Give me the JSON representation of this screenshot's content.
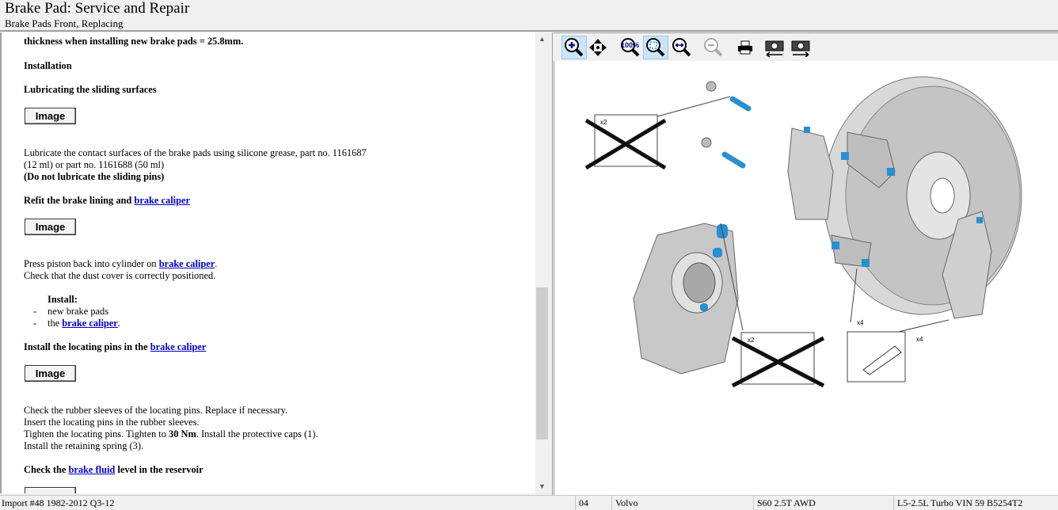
{
  "header": {
    "title": "Brake Pad:  Service and Repair",
    "subtitle": "Brake Pads Front, Replacing"
  },
  "content": {
    "top_line": "thickness when installing new brake pads = 25.8mm.",
    "installation": "Installation",
    "lubricating": "Lubricating the sliding surfaces",
    "image_button": "Image",
    "lubricate_1": "Lubricate the contact surfaces of the brake pads using silicone grease, part no. 1161687",
    "lubricate_2": "(12 ml) or part no. 1161688 (50 ml)",
    "lubricate_3": "(Do not lubricate the sliding pins)",
    "refit_prefix": "Refit the brake lining and ",
    "brake_caliper": "brake caliper",
    "press_prefix": "Press piston back into cylinder on ",
    "press_suffix": ".",
    "check_dust": "Check that the dust cover is correctly positioned.",
    "install_label": "Install:",
    "dash": "-",
    "new_pads": "new brake pads",
    "the": "the ",
    "period": ".",
    "install_pins_prefix": "Install the locating pins in the ",
    "check_sleeves": "Check the rubber sleeves of the locating pins. Replace if necessary.",
    "insert_pins": "Insert the locating pins in the rubber sleeves.",
    "tighten_prefix": "Tighten the locating pins. Tighten to ",
    "torque": "30 Nm",
    "tighten_suffix": ". Install the protective caps (1).",
    "retaining": "Install the retaining spring (3).",
    "check_prefix": "Check the ",
    "brake_fluid": "brake fluid",
    "check_suffix": " level in the reservoir"
  },
  "toolbar": {
    "items": [
      "zoom-in",
      "pan",
      "zoom-100",
      "zoom-fit",
      "zoom-width",
      "zoom-out",
      "print",
      "previous-image",
      "next-image"
    ]
  },
  "diagram": {
    "labels": [
      "x2",
      "x2",
      "x4",
      "x4"
    ],
    "accent": "#2a8fd0"
  },
  "status": {
    "import": "Import #48 1982-2012 Q3-12",
    "code": "04",
    "make": "Volvo",
    "model": "S60 2.5T AWD",
    "engine": "L5-2.5L Turbo VIN 59 B5254T2"
  }
}
